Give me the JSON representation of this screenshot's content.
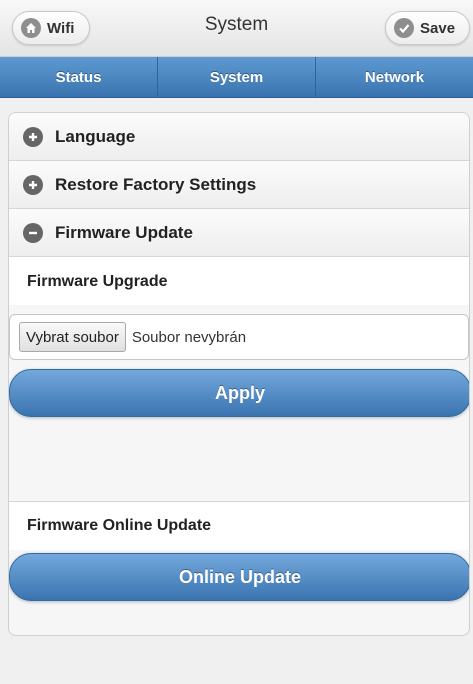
{
  "header": {
    "title": "System",
    "wifi_label": "Wifi",
    "save_label": "Save"
  },
  "tabs": [
    {
      "label": "Status"
    },
    {
      "label": "System"
    },
    {
      "label": "Network"
    }
  ],
  "sections": {
    "language": "Language",
    "restore": "Restore Factory Settings",
    "firmware": "Firmware Update"
  },
  "firmware": {
    "upgrade_label": "Firmware Upgrade",
    "choose_file": "Vybrat soubor",
    "no_file": "Soubor nevybrán",
    "apply_label": "Apply",
    "online_label": "Firmware Online Update",
    "online_button": "Online Update"
  },
  "icons": {
    "wifi": "home-icon",
    "save": "check-icon",
    "expand": "plus-icon",
    "collapse": "minus-icon"
  },
  "colors": {
    "accent": "#3a74b0",
    "accent_light": "#73a8db"
  }
}
